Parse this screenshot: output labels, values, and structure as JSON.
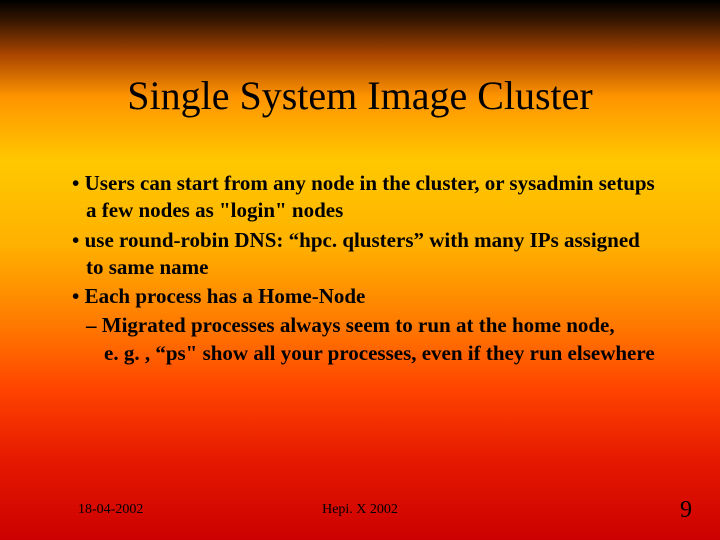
{
  "title": "Single System Image Cluster",
  "bullets": {
    "b1": "• Users can start from any node in the cluster, or sysadmin setups a few nodes as \"login\" nodes",
    "b2": "• use round-robin DNS:  “hpc. qlusters” with many IPs assigned to same name",
    "b3": "• Each process has a Home-Node",
    "s1": "– Migrated processes always seem to run at the home node,\ne. g. , “ps\" show all your processes, even if they run elsewhere"
  },
  "footer": {
    "date": "18-04-2002",
    "venue": "Hepi. X 2002",
    "page": "9"
  }
}
